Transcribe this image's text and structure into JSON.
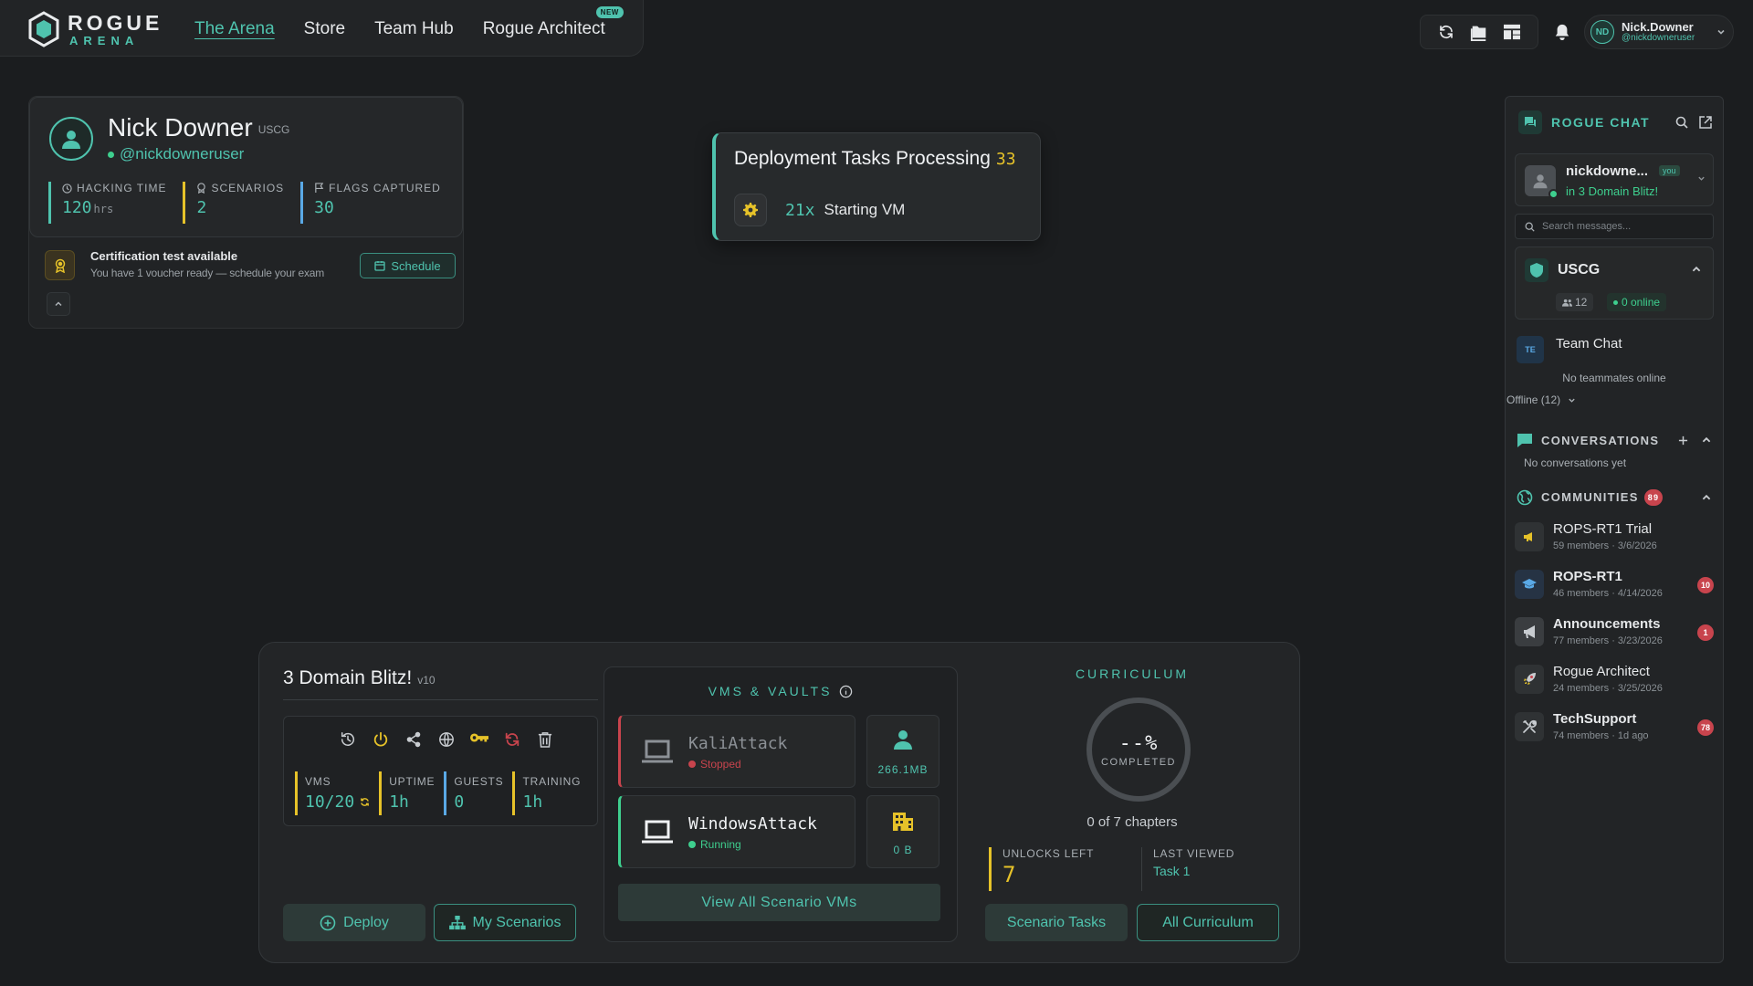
{
  "app": {
    "brand_line1": "ROGUE",
    "brand_line2": "ARENA",
    "accent_color": "#4fc3ae"
  },
  "nav": {
    "items": [
      {
        "label": "The Arena",
        "active": true
      },
      {
        "label": "Store"
      },
      {
        "label": "Team Hub"
      },
      {
        "label": "Rogue Architect",
        "badge": "NEW"
      }
    ]
  },
  "header": {
    "icons": [
      "refresh-icon",
      "folder-icon",
      "layout-icon",
      "bell-icon"
    ],
    "user": {
      "initials": "ND",
      "name": "Nick.Downer",
      "handle": "@nickdowneruser"
    }
  },
  "profile": {
    "name": "Nick Downer",
    "org": "USCG",
    "handle": "@nickdowneruser",
    "stats": [
      {
        "label": "HACKING TIME",
        "value": "120",
        "unit": "hrs"
      },
      {
        "label": "SCENARIOS",
        "value": "2"
      },
      {
        "label": "FLAGS CAPTURED",
        "value": "30"
      }
    ],
    "cert": {
      "title": "Certification test available",
      "subtitle": "You have 1 voucher ready — schedule your exam",
      "button": "Schedule"
    }
  },
  "deployment": {
    "title": "Deployment Tasks Processing",
    "count": "33",
    "task_multiplier": "21x",
    "task_label": "Starting VM"
  },
  "scenario": {
    "title": "3 Domain Blitz!",
    "version": "v10",
    "tools": [
      "history-icon",
      "power-icon",
      "share-icon",
      "globe-icon",
      "key-icon",
      "reset-icon",
      "trash-icon"
    ],
    "stats": [
      {
        "label": "VMS",
        "value": "10/20"
      },
      {
        "label": "UPTIME",
        "value": "1h"
      },
      {
        "label": "GUESTS",
        "value": "0"
      },
      {
        "label": "TRAINING",
        "value": "1h"
      }
    ],
    "deploy_label": "Deploy",
    "my_scenarios_label": "My Scenarios"
  },
  "vms": {
    "title": "VMS & VAULTS",
    "items": [
      {
        "name": "KaliAttack",
        "status": "Stopped"
      },
      {
        "name": "WindowsAttack",
        "status": "Running"
      }
    ],
    "resources": [
      {
        "value": "266.1MB",
        "icon": "user-icon"
      },
      {
        "value": "0 B",
        "icon": "building-icon"
      }
    ],
    "view_all_label": "View All Scenario VMs"
  },
  "curriculum": {
    "title": "CURRICULUM",
    "percent": "--%",
    "completed_label": "COMPLETED",
    "chapters": "0 of 7 chapters",
    "unlocks_label": "UNLOCKS LEFT",
    "unlocks_value": "7",
    "last_viewed_label": "LAST VIEWED",
    "last_viewed_value": "Task 1",
    "tasks_button": "Scenario Tasks",
    "all_button": "All Curriculum"
  },
  "chat": {
    "title": "ROGUE CHAT",
    "me": {
      "name": "nickdowne...",
      "you": "you",
      "status": "in 3 Domain Blitz!"
    },
    "search_placeholder": "Search messages...",
    "team": {
      "name": "USCG",
      "members": "12",
      "online": "0 online"
    },
    "team_chat": {
      "initials": "TE",
      "name": "Team Chat"
    },
    "no_teammates": "No teammates online",
    "offline": "Offline (12)",
    "conversations_title": "CONVERSATIONS",
    "no_conversations": "No conversations yet",
    "communities_title": "COMMUNITIES",
    "communities_count": "89",
    "communities": [
      {
        "name": "ROPS-RT1 Trial",
        "meta": "59 members  ·  3/6/2026",
        "badge": "",
        "bold": false,
        "icon": "megaphone-icon"
      },
      {
        "name": "ROPS-RT1",
        "meta": "46 members  ·  4/14/2026",
        "badge": "10",
        "bold": true,
        "icon": "graduation-cap-icon"
      },
      {
        "name": "Announcements",
        "meta": "77 members  ·  3/23/2026",
        "badge": "1",
        "bold": true,
        "icon": "bullhorn-icon"
      },
      {
        "name": "Rogue Architect",
        "meta": "24 members  ·  3/25/2026",
        "badge": "",
        "bold": false,
        "icon": "rocket-icon"
      },
      {
        "name": "TechSupport",
        "meta": "74 members  ·  1d ago",
        "badge": "78",
        "bold": true,
        "icon": "tools-icon"
      }
    ]
  }
}
